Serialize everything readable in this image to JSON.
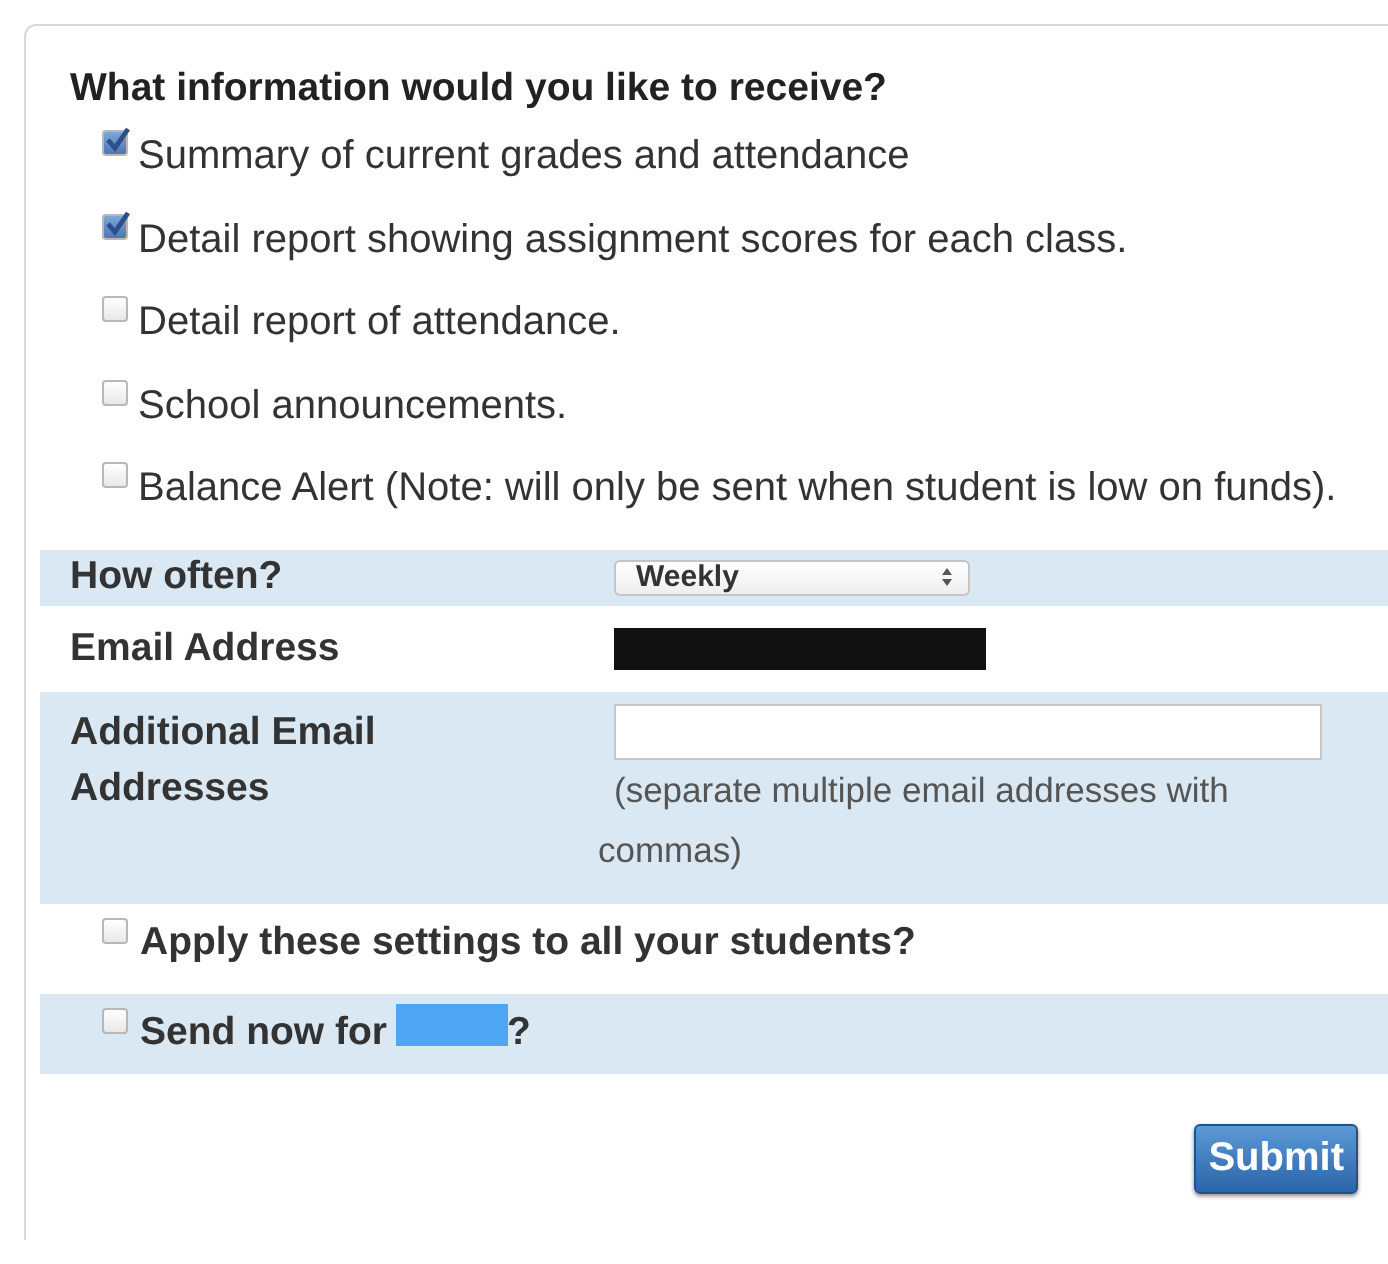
{
  "heading": "What information would you like to receive?",
  "options": [
    {
      "label": "Summary of current grades and attendance",
      "checked": true
    },
    {
      "label": "Detail report showing assignment scores for each class.",
      "checked": true
    },
    {
      "label": "Detail report of attendance.",
      "checked": false
    },
    {
      "label": "School announcements.",
      "checked": false
    },
    {
      "label": "Balance Alert (Note: will only be sent when student is low on funds).",
      "checked": false
    }
  ],
  "frequency": {
    "label": "How often?",
    "value": "Weekly"
  },
  "email": {
    "label": "Email Address",
    "redacted": true
  },
  "additional_email": {
    "label": "Additional Email Addresses",
    "hint": "(separate multiple email addresses with commas)"
  },
  "apply_all": {
    "label": "Apply these settings to all your students?",
    "checked": false
  },
  "send_now": {
    "label_before": "Send now for",
    "name_redacted": true,
    "label_after": "?",
    "checked": false
  },
  "submit": "Submit"
}
